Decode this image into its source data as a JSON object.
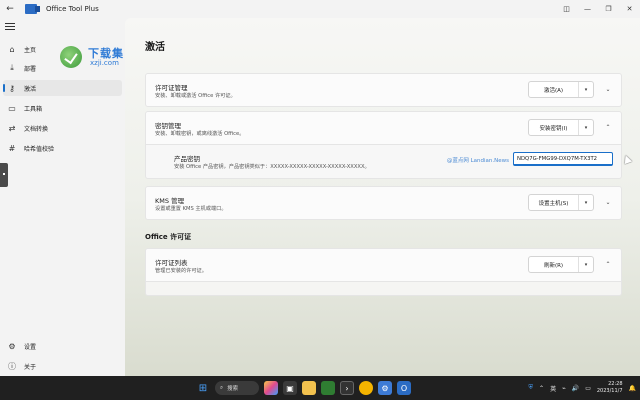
{
  "app": {
    "title": "Office Tool Plus"
  },
  "sidebar": {
    "items": [
      {
        "label": "主页",
        "icon": "home-icon"
      },
      {
        "label": "部署",
        "icon": "deploy-icon"
      },
      {
        "label": "激活",
        "icon": "key-icon",
        "active": true
      },
      {
        "label": "工具箱",
        "icon": "toolbox-icon"
      },
      {
        "label": "文档转换",
        "icon": "document-convert-icon"
      },
      {
        "label": "哈希值校验",
        "icon": "hash-check-icon"
      }
    ],
    "footer": [
      {
        "label": "设置",
        "icon": "gear-icon"
      },
      {
        "label": "关于",
        "icon": "info-icon"
      }
    ]
  },
  "watermark": {
    "brand": "下载集",
    "site": "xzji.com"
  },
  "main": {
    "title": "激活",
    "license_card": {
      "title": "许可证管理",
      "desc": "安装、卸载或激活 Office 许可证。",
      "button": "激活(A)"
    },
    "key_card": {
      "title": "密钥管理",
      "desc": "安装、卸载密钥，或离线激活 Office。",
      "button": "安装密钥(I)"
    },
    "product_key": {
      "title": "产品密钥",
      "desc": "安装 Office 产品密钥，产品密钥类似于：XXXXX-XXXXX-XXXXX-XXXXX-XXXXX。",
      "value": "NDQ7G-FMG99-DXQ7M-TX3T2",
      "watermark": "@蓝点网 Landian.News"
    },
    "kms_card": {
      "title": "KMS 管理",
      "desc": "设置或重置 KMS 主机或端口。",
      "button": "设置主机(S)"
    },
    "section_office_license": "Office 许可证",
    "license_list_card": {
      "title": "许可证列表",
      "desc": "管理已安装的许可证。",
      "button": "刷新(R)"
    }
  },
  "taskbar": {
    "search_label": "搜索",
    "tray": {
      "lang": "英",
      "time": "22:28",
      "date": "2023/11/7"
    }
  },
  "colors": {
    "accent": "#1a6fc9"
  }
}
